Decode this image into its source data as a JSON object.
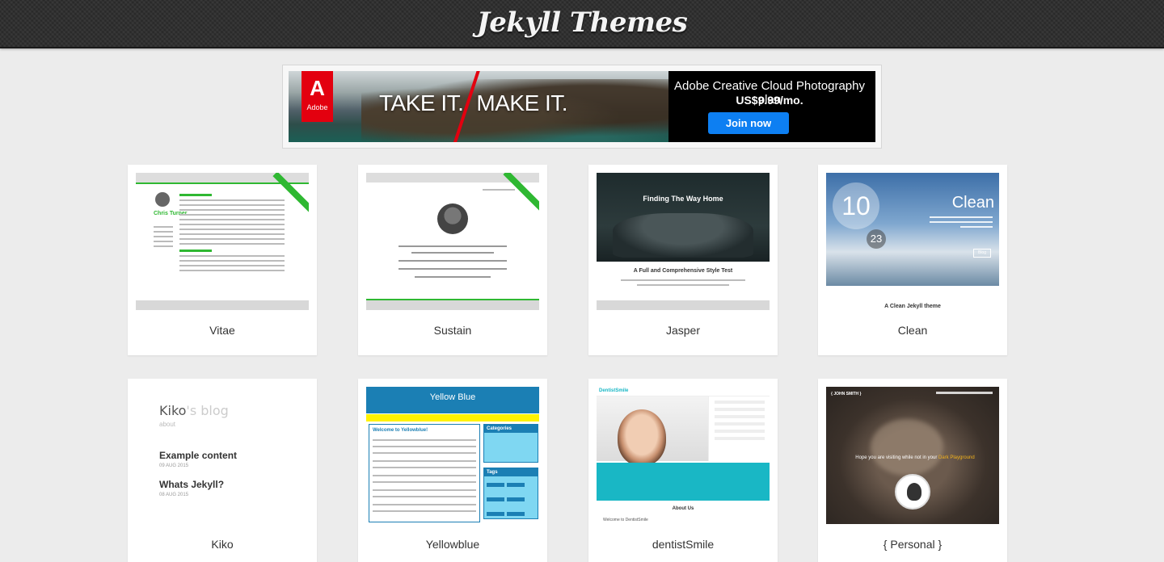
{
  "header": {
    "title": "Jekyll Themes"
  },
  "ad": {
    "brand": "Adobe",
    "logo_letter": "A",
    "headline_left": "TAKE IT.",
    "headline_right": "MAKE IT.",
    "product": "Adobe Creative Cloud Photography plan",
    "price": "US$9.99/mo.",
    "cta": "Join now",
    "accent_color": "#e3000f",
    "button_color": "#0d7ff2"
  },
  "themes": [
    {
      "name": "Vitae",
      "preview": {
        "person": "Chris Turner"
      }
    },
    {
      "name": "Sustain",
      "preview": {}
    },
    {
      "name": "Jasper",
      "preview": {
        "hero_title": "Finding The Way Home",
        "post_title": "A Full and Comprehensive Style Test"
      }
    },
    {
      "name": "Clean",
      "preview": {
        "day": "10",
        "date": "23",
        "title": "Clean",
        "button": "Blog",
        "caption": "A Clean Jekyll theme"
      }
    },
    {
      "name": "Kiko",
      "preview": {
        "brand": "Kiko",
        "brand_suffix": "'s blog",
        "about": "about",
        "posts": [
          {
            "title": "Example content",
            "date": "09 AUG 2015"
          },
          {
            "title": "Whats Jekyll?",
            "date": "08 AUG 2015"
          }
        ]
      }
    },
    {
      "name": "Yellowblue",
      "preview": {
        "title": "Yellow Blue",
        "post_title": "Welcome to Yellowblue!",
        "categories": "Categories",
        "tags": "Tags"
      }
    },
    {
      "name": "dentistSmile",
      "preview": {
        "logo": "DentistSmile",
        "about": "About Us",
        "welcome": "Welcome to DentistSmile"
      }
    },
    {
      "name": "{ Personal }",
      "preview": {
        "brand": "{ JOHN SMITH }",
        "hope": "Hope you are visiting while not in your",
        "hope_highlight": "Dark Playground"
      }
    }
  ]
}
